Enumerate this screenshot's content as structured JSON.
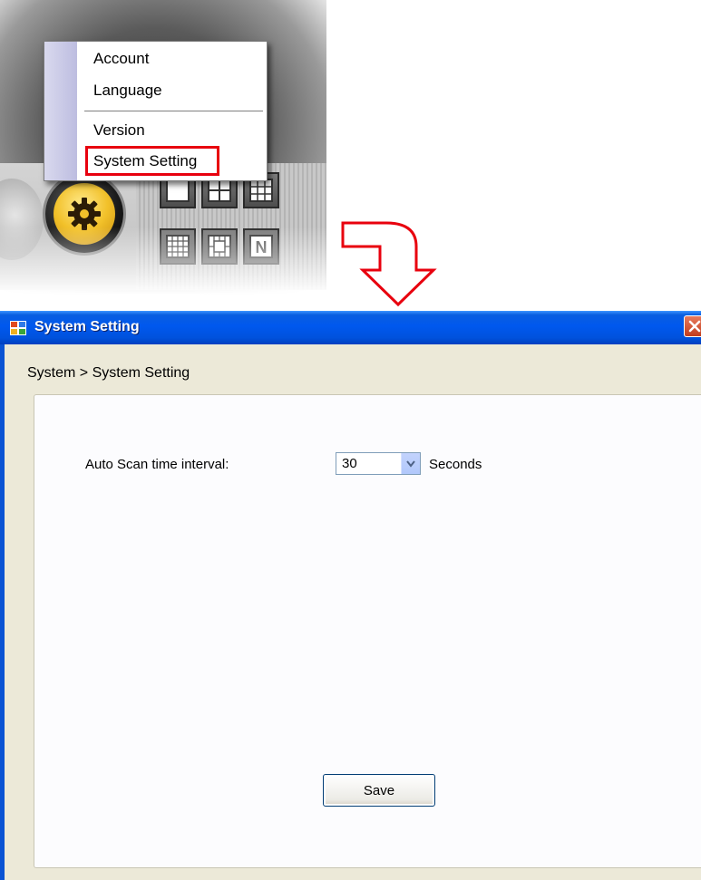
{
  "context_menu": {
    "items": [
      {
        "label": "Account"
      },
      {
        "label": "Language"
      },
      {
        "label": "Version"
      },
      {
        "label": "System Setting"
      }
    ],
    "highlighted": "System Setting",
    "highlight_color": "#e8000e"
  },
  "toolbar": {
    "icons": [
      "power-icon",
      "gear-icon",
      "layout-1x1-icon",
      "layout-2x2-icon",
      "layout-3x3-icon",
      "layout-4x4-icon",
      "layout-custom-icon",
      "layout-n-icon"
    ],
    "layout_n_label": "N"
  },
  "dialog": {
    "title": "System Setting",
    "breadcrumb": "System > System Setting",
    "scan_label": "Auto Scan time interval:",
    "scan_value": "30",
    "scan_unit": "Seconds",
    "save_label": "Save",
    "title_bar_color": "#0058ee"
  }
}
